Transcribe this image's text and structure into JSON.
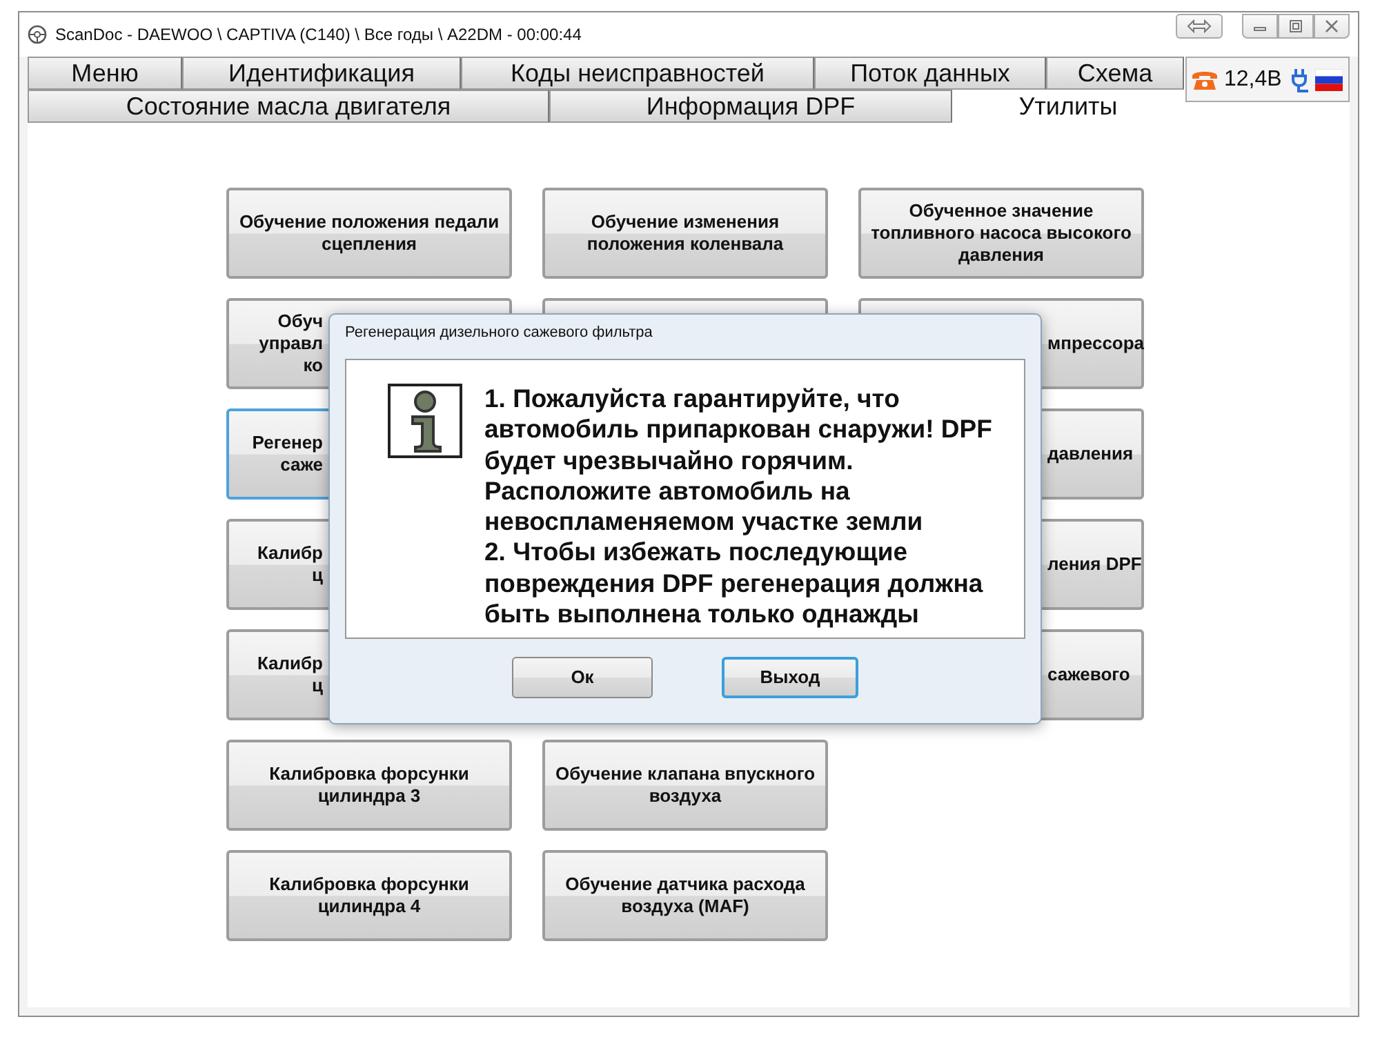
{
  "window": {
    "title": "ScanDoc - DAEWOO \\ CAPTIVA (C140) \\ Все годы \\ A22DM - 00:00:44"
  },
  "tabs_top": [
    {
      "label": "Меню",
      "selected": false
    },
    {
      "label": "Идентификация",
      "selected": false
    },
    {
      "label": "Коды неисправностей",
      "selected": false
    },
    {
      "label": "Поток данных",
      "selected": false
    },
    {
      "label": "Схема",
      "selected": false
    }
  ],
  "tabs_bottom": [
    {
      "label": "Состояние масла двигателя",
      "selected": false
    },
    {
      "label": "Информация DPF",
      "selected": false
    },
    {
      "label": "Утилиты",
      "selected": true
    }
  ],
  "status": {
    "voltage": "12,4В"
  },
  "buttons": [
    {
      "kind": "full",
      "label": "Обучение положения педали сцепления",
      "selected": false
    },
    {
      "kind": "full",
      "label": "Обучение изменения положения коленвала",
      "selected": false
    },
    {
      "kind": "full",
      "label": "Обученное значение топливного насоса высокого давления",
      "selected": false
    },
    {
      "kind": "right-hidden",
      "lines": [
        "Обуч",
        "управл",
        "ко"
      ],
      "selected": false
    },
    {
      "kind": "covered",
      "selected": false
    },
    {
      "kind": "left-hidden",
      "lines": [
        "мпрессора"
      ],
      "selected": false
    },
    {
      "kind": "right-hidden",
      "lines": [
        "Регенер",
        "саже"
      ],
      "selected": true
    },
    {
      "kind": "hidden"
    },
    {
      "kind": "left-hidden",
      "lines": [
        "давления"
      ],
      "selected": false
    },
    {
      "kind": "right-hidden",
      "lines": [
        "Калибр",
        "ц"
      ],
      "selected": false
    },
    {
      "kind": "hidden"
    },
    {
      "kind": "left-hidden",
      "lines": [
        "ления DPF"
      ],
      "selected": false
    },
    {
      "kind": "right-hidden",
      "lines": [
        "Калибр",
        "ц"
      ],
      "selected": false
    },
    {
      "kind": "hidden"
    },
    {
      "kind": "left-hidden",
      "lines": [
        "сажевого"
      ],
      "selected": false
    },
    {
      "kind": "full",
      "label": "Калибровка форсунки цилиндра 3",
      "selected": false
    },
    {
      "kind": "full",
      "label": "Обучение клапана впускного воздуха",
      "selected": false
    },
    {
      "kind": "hidden"
    },
    {
      "kind": "full",
      "label": "Калибровка форсунки цилиндра 4",
      "selected": false
    },
    {
      "kind": "full",
      "label": "Обучение датчика расхода воздуха (MAF)",
      "selected": false
    }
  ],
  "dialog": {
    "title": "Регенерация дизельного сажевого фильтра",
    "message": "1. Пожалуйста гарантируйте, что\nавтомобиль припаркован снаружи! DPF\nбудет чрезвычайно горячим.\nРасположите автомобиль на\nневоспламеняемом участке земли\n2. Чтобы избежать последующие\nповреждения DPF регенерация должна\nбыть выполнена только однажды",
    "buttons": [
      {
        "label": "Ок",
        "focused": false
      },
      {
        "label": "Выход",
        "focused": true
      }
    ]
  }
}
